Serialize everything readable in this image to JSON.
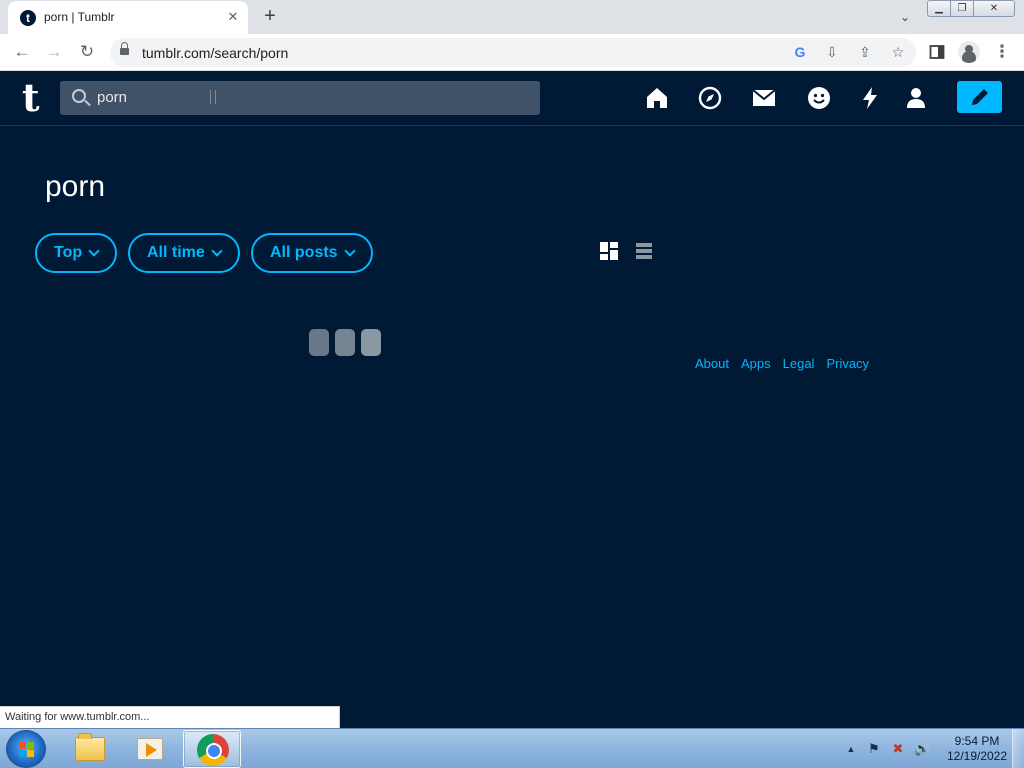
{
  "browser": {
    "tab_title": "porn | Tumblr",
    "tab_favicon": "t",
    "new_tab_label": "+",
    "url": "tumblr.com/search/porn",
    "status_text": "Waiting for www.tumblr.com..."
  },
  "tumblr": {
    "logo": "t",
    "search_query": "porn",
    "nav_icons": [
      "home-icon",
      "explore-icon",
      "inbox-icon",
      "messages-icon",
      "activity-icon",
      "account-icon",
      "compose-icon"
    ],
    "accent": "#00b8ff",
    "background": "#001935"
  },
  "search": {
    "title": "porn",
    "filters": [
      "Top",
      "All time",
      "All posts"
    ],
    "views": [
      "grid-view-icon",
      "list-view-icon"
    ]
  },
  "footer": {
    "links": [
      "About",
      "Apps",
      "Legal",
      "Privacy"
    ]
  },
  "taskbar": {
    "time": "9:54 PM",
    "date": "12/19/2022"
  }
}
